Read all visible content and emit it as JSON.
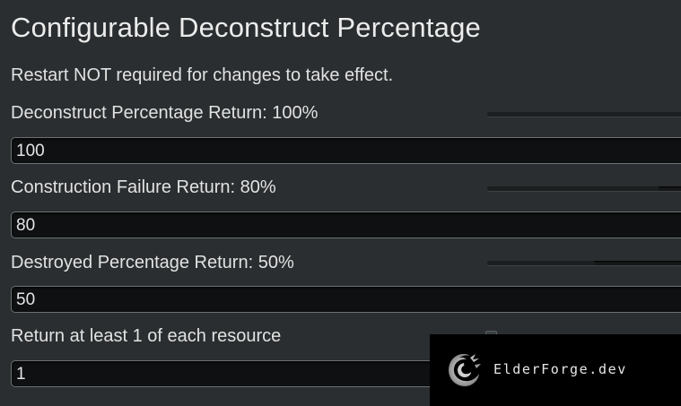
{
  "window": {
    "title": "Configurable Deconstruct Percentage",
    "note": "Restart NOT required for changes to take effect."
  },
  "settings": [
    {
      "label": "Deconstruct Percentage Return: 100%",
      "slider_value_fraction": 1.0,
      "field_value": "100"
    },
    {
      "label": "Construction Failure Return: 80%",
      "slider_value_fraction": 0.8,
      "field_value": "80"
    },
    {
      "label": "Destroyed Percentage Return: 50%",
      "slider_value_fraction": 0.5,
      "field_value": "50"
    },
    {
      "label": "Return at least 1 of each resource",
      "checkbox_checked": false,
      "field_value": "1"
    }
  ],
  "watermark": {
    "text": "ElderForge.dev",
    "icon": "dragon-logo-icon"
  },
  "colors": {
    "background": "#2a2e30",
    "field_background": "#0e1011",
    "field_border": "#6c7173",
    "text": "#e2e2e2",
    "watermark_background": "#000000"
  }
}
